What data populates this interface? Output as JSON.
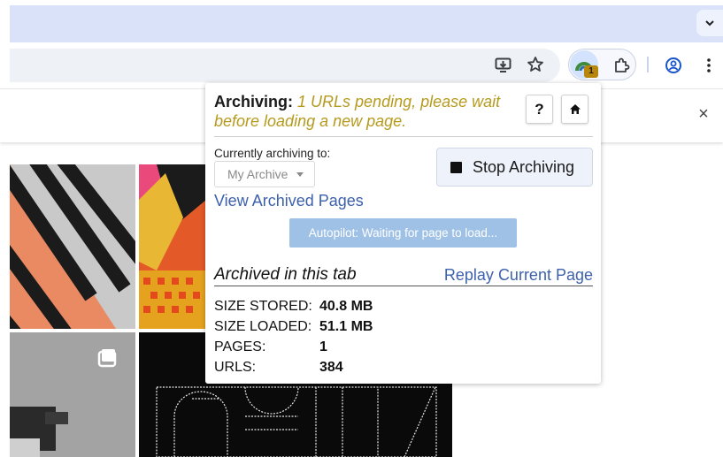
{
  "browser": {
    "tab_search_icon": "chevron-down-icon",
    "toolbar_icons": [
      "install-app-icon",
      "bookmark-star-icon",
      "archiveweb-extension-icon",
      "extensions-puzzle-icon",
      "profile-icon",
      "more-menu-icon"
    ],
    "extension_badge": "1",
    "infobar_close": "×"
  },
  "popup": {
    "title_bold": "Archiving:",
    "title_status": " 1 URLs pending, please wait before loading a new page.",
    "help_button": "?",
    "home_button": "⌂",
    "currently_archiving_label": "Currently archiving to:",
    "archive_select_value": "My Archive",
    "stop_button": "Stop Archiving",
    "view_archived_link": "View Archived Pages",
    "autopilot_button": "Autopilot: Waiting for page to load...",
    "section_title": "Archived in this tab",
    "replay_link": "Replay Current Page",
    "stats": [
      {
        "label": "SIZE STORED:",
        "value": "40.8 MB"
      },
      {
        "label": "SIZE LOADED:",
        "value": "51.1 MB"
      },
      {
        "label": "PAGES:",
        "value": "1"
      },
      {
        "label": "URLS:",
        "value": "384"
      }
    ]
  },
  "colors": {
    "tabstrip": "#dae2f9",
    "status_text": "#b69a1e",
    "link": "#3d61ad",
    "autopilot_bg": "#9fc1e6"
  }
}
